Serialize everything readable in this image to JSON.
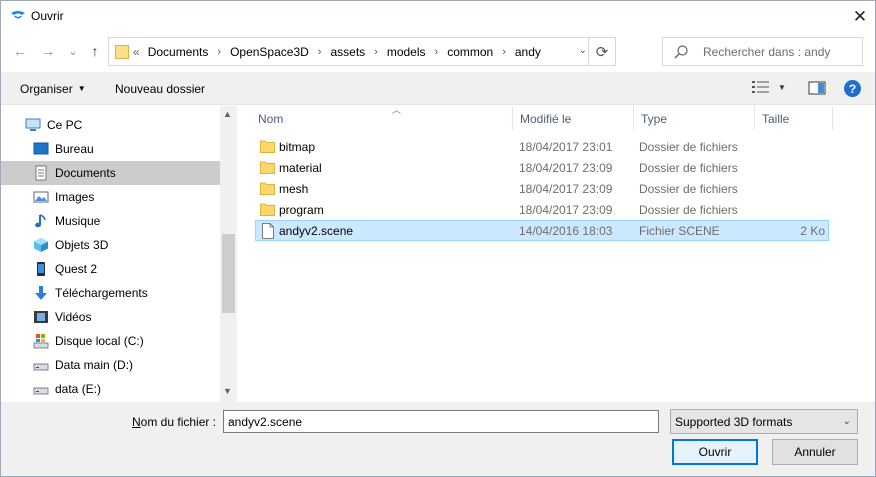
{
  "window": {
    "title": "Ouvrir",
    "close": "✕"
  },
  "nav": {
    "back": "←",
    "forward": "→",
    "recent": "⌄",
    "up": "↑",
    "crumb_lead": "«",
    "breadcrumbs": [
      "Documents",
      "OpenSpace3D",
      "assets",
      "models",
      "common",
      "andy"
    ],
    "separator": "›",
    "address_dropdown": "⌄",
    "refresh": "⟳",
    "search_placeholder": "Rechercher dans : andy"
  },
  "toolbar": {
    "organize": "Organiser",
    "organize_caret": "▼",
    "new_folder": "Nouveau dossier",
    "view_caret": "▼",
    "help": "?"
  },
  "sidebar": {
    "items": [
      {
        "label": "Ce PC",
        "icon": "computer-icon"
      },
      {
        "label": "Bureau",
        "icon": "desktop-icon"
      },
      {
        "label": "Documents",
        "icon": "documents-icon",
        "selected": true
      },
      {
        "label": "Images",
        "icon": "pictures-icon"
      },
      {
        "label": "Musique",
        "icon": "music-icon"
      },
      {
        "label": "Objets 3D",
        "icon": "objects-3d-icon"
      },
      {
        "label": "Quest 2",
        "icon": "phone-icon"
      },
      {
        "label": "Téléchargements",
        "icon": "downloads-icon"
      },
      {
        "label": "Vidéos",
        "icon": "videos-icon"
      },
      {
        "label": "Disque local (C:)",
        "icon": "drive-c-icon"
      },
      {
        "label": "Data main (D:)",
        "icon": "drive-icon"
      },
      {
        "label": "data (E:)",
        "icon": "drive-icon"
      }
    ],
    "scroll_up": "▲",
    "scroll_down": "▼"
  },
  "filelist": {
    "sort_indicator": "︿",
    "columns": [
      "Nom",
      "Modifié le",
      "Type",
      "Taille"
    ],
    "rows": [
      {
        "name": "bitmap",
        "modified": "18/04/2017 23:01",
        "type": "Dossier de fichiers",
        "size": "",
        "kind": "folder"
      },
      {
        "name": "material",
        "modified": "18/04/2017 23:09",
        "type": "Dossier de fichiers",
        "size": "",
        "kind": "folder"
      },
      {
        "name": "mesh",
        "modified": "18/04/2017 23:09",
        "type": "Dossier de fichiers",
        "size": "",
        "kind": "folder"
      },
      {
        "name": "program",
        "modified": "18/04/2017 23:09",
        "type": "Dossier de fichiers",
        "size": "",
        "kind": "folder"
      },
      {
        "name": "andyv2.scene",
        "modified": "14/04/2016 18:03",
        "type": "Fichier SCENE",
        "size": "2 Ko",
        "kind": "file",
        "selected": true
      }
    ]
  },
  "footer": {
    "filename_label_underlined": "N",
    "filename_label_rest": "om du fichier :",
    "filename_value": "andyv2.scene",
    "filename_dropdown": "⌄",
    "filter_value": "Supported 3D formats",
    "filter_dropdown": "⌄",
    "open_button": "Ouvrir",
    "cancel_button": "Annuler"
  },
  "colors": {
    "accent": "#0078d7",
    "selection": "#cce8ff",
    "folder": "#ffd766"
  }
}
